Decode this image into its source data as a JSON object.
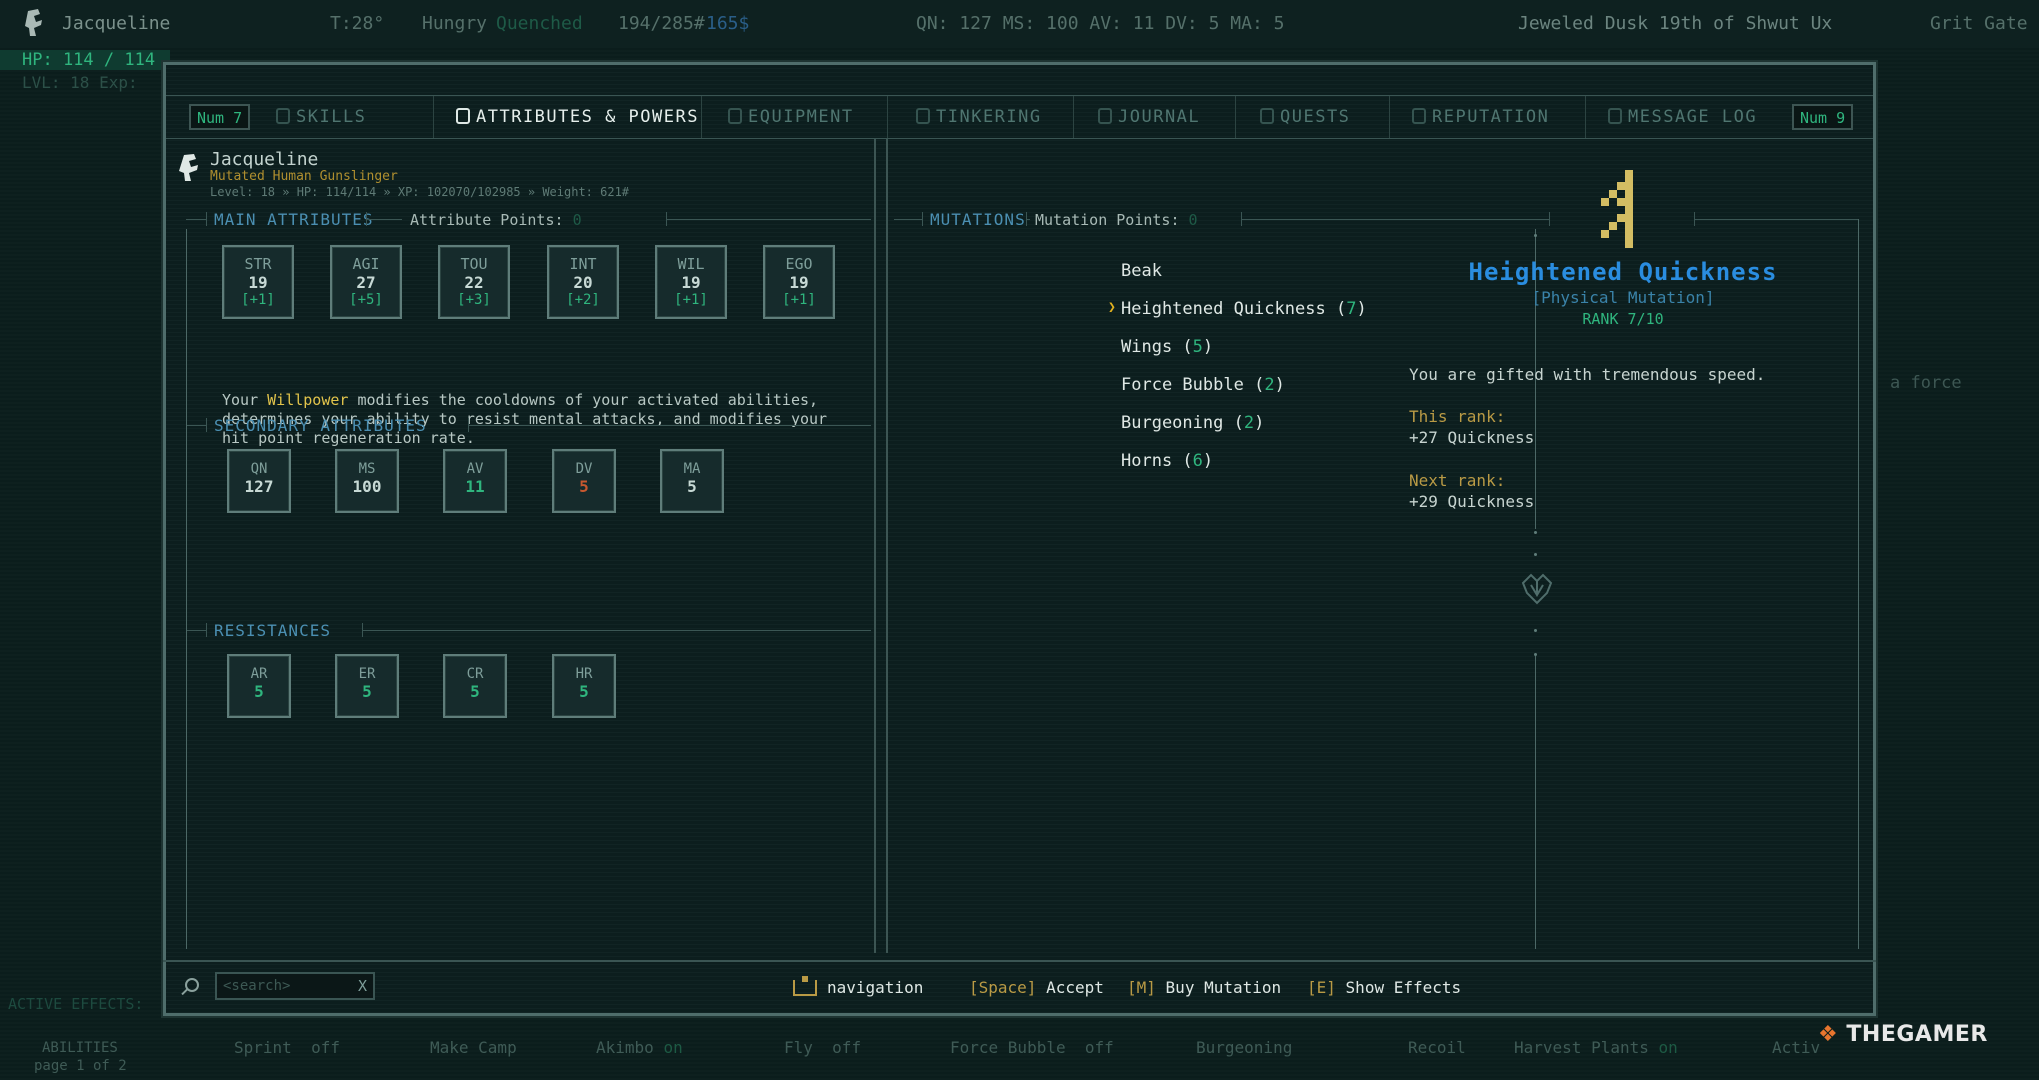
{
  "topbar": {
    "name": "Jacqueline",
    "temp": "T:28°",
    "hunger": "Hungry",
    "thirst": "Quenched",
    "weight": "194/285#",
    "money": "165$",
    "stats": "QN: 127  MS: 100  AV: 11  DV: 5  MA: 5",
    "date": "Jeweled Dusk 19th of Shwut Ux",
    "location": "Grit Gate"
  },
  "hud": {
    "hp": "HP: 114 / 114",
    "lvl": "LVL: 18 Exp:",
    "active_effects": "ACTIVE EFFECTS:",
    "abilities": "ABILITIES",
    "page": "page 1 of 2",
    "ghost_text": "a force"
  },
  "ability_bar": [
    {
      "name": "Sprint",
      "state": "off"
    },
    {
      "name": "Make Camp",
      "state": ""
    },
    {
      "name": "Akimbo",
      "state": "on"
    },
    {
      "name": "Fly",
      "state": "off"
    },
    {
      "name": "Force Bubble",
      "state": "off"
    },
    {
      "name": "Burgeoning",
      "state": ""
    },
    {
      "name": "Recoil",
      "state": ""
    },
    {
      "name": "Harvest Plants",
      "state": "on"
    },
    {
      "name": "Activ",
      "state": ""
    }
  ],
  "tabs": {
    "num_left": "Num 7",
    "num_right": "Num 9",
    "items": [
      {
        "label": "SKILLS"
      },
      {
        "label": "ATTRIBUTES & POWERS"
      },
      {
        "label": "EQUIPMENT"
      },
      {
        "label": "TINKERING"
      },
      {
        "label": "JOURNAL"
      },
      {
        "label": "QUESTS"
      },
      {
        "label": "REPUTATION"
      },
      {
        "label": "MESSAGE LOG"
      }
    ]
  },
  "character": {
    "name": "Jacqueline",
    "subtitle": "Mutated Human Gunslinger",
    "info": "Level: 18 » HP: 114/114 » XP: 102070/102985 » Weight: 621#"
  },
  "main_attributes": {
    "heading": "MAIN ATTRIBUTES",
    "points_label": "Attribute Points:",
    "points_value": "0",
    "items": [
      {
        "key": "STR",
        "value": "19",
        "mod": "[+1]"
      },
      {
        "key": "AGI",
        "value": "27",
        "mod": "[+5]"
      },
      {
        "key": "TOU",
        "value": "22",
        "mod": "[+3]"
      },
      {
        "key": "INT",
        "value": "20",
        "mod": "[+2]"
      },
      {
        "key": "WIL",
        "value": "19",
        "mod": "[+1]"
      },
      {
        "key": "EGO",
        "value": "19",
        "mod": "[+1]"
      }
    ]
  },
  "description": {
    "before": "Your ",
    "highlight": "Willpower",
    "after": " modifies the cooldowns of your activated abilities, determines your ability to resist mental attacks, and modifies your hit point regeneration rate."
  },
  "secondary_attributes": {
    "heading": "SECONDARY ATTRIBUTES",
    "items": [
      {
        "key": "QN",
        "value": "127",
        "color": "#c7d9d5"
      },
      {
        "key": "MS",
        "value": "100",
        "color": "#c7d9d5"
      },
      {
        "key": "AV",
        "value": "11",
        "color": "#2fb57e"
      },
      {
        "key": "DV",
        "value": "5",
        "color": "#c7582f"
      },
      {
        "key": "MA",
        "value": "5",
        "color": "#c7d9d5"
      }
    ]
  },
  "resistances": {
    "heading": "RESISTANCES",
    "items": [
      {
        "key": "AR",
        "value": "5"
      },
      {
        "key": "ER",
        "value": "5"
      },
      {
        "key": "CR",
        "value": "5"
      },
      {
        "key": "HR",
        "value": "5"
      }
    ]
  },
  "mutations": {
    "heading": "MUTATIONS",
    "points_label": "Mutation Points:",
    "points_value": "0",
    "items": [
      {
        "name": "Beak",
        "level": ""
      },
      {
        "name": "Heightened Quickness",
        "level": "7"
      },
      {
        "name": "Wings",
        "level": "5"
      },
      {
        "name": "Force Bubble",
        "level": "2"
      },
      {
        "name": "Burgeoning",
        "level": "2"
      },
      {
        "name": "Horns",
        "level": "6"
      }
    ],
    "selected": 1
  },
  "detail": {
    "title": "Heightened Quickness",
    "type": "[Physical Mutation]",
    "rank": "RANK 7/10",
    "description": "You are gifted with tremendous speed.",
    "this_rank_label": "This rank:",
    "this_rank_value": "+27 Quickness",
    "next_rank_label": "Next rank:",
    "next_rank_value": "+29 Quickness"
  },
  "footer": {
    "search_placeholder": "<search>",
    "clear": "X",
    "nav": "navigation",
    "space_key": "[Space]",
    "space_action": "Accept",
    "m_key": "[M]",
    "m_action": "Buy Mutation",
    "e_key": "[E]",
    "e_action": "Show Effects"
  },
  "watermark": {
    "brand": "THEGAMER"
  },
  "colors": {
    "accent_blue": "#2a8de0",
    "heading_blue": "#4b8fb2",
    "green": "#2fb57e",
    "gold": "#e2c44b",
    "orange": "#c7582f"
  }
}
